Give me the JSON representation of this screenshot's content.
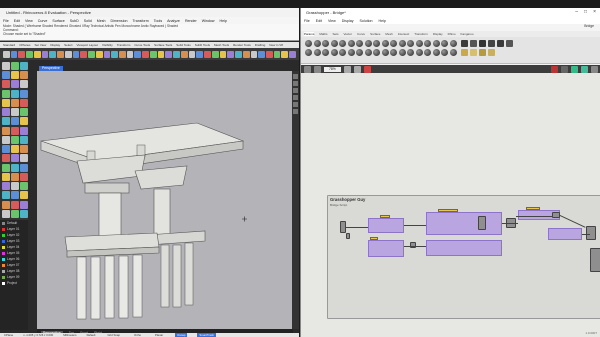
{
  "rhino": {
    "title": "Untitled - Rhinoceros 8 Evaluation - Perspective",
    "menu": [
      "File",
      "Edit",
      "View",
      "Curve",
      "Surface",
      "SubD",
      "Solid",
      "Mesh",
      "Dimension",
      "Transform",
      "Tools",
      "Analyze",
      "Render",
      "Window",
      "Help"
    ],
    "command_history": [
      "Mode: Shaded ( Wireframe Shaded Rendered Ghosted XRay Technical Artistic Pen Monochrome Arctic Raytraced ) Shaded",
      "Command:",
      "Choose mode set to \"Shaded\""
    ],
    "toolbar_tabs": [
      "Standard",
      "CPlanes",
      "Set View",
      "Display",
      "Select",
      "Viewport Layout",
      "Visibility",
      "Transform",
      "Curve Tools",
      "Surface Tools",
      "Solid Tools",
      "SubD Tools",
      "Mesh Tools",
      "Render Tools",
      "Drafting",
      "New in V8"
    ],
    "viewport_label": "Perspective",
    "layers": [
      "Default",
      "Layer 01",
      "Layer 02",
      "Layer 03",
      "Layer 04",
      "Layer 05",
      "Layer 06",
      "Layer 07",
      "Layer 08",
      "Layer 09",
      "Project"
    ],
    "view_tabs": [
      "Perspective",
      "Top",
      "Front",
      "Right"
    ],
    "status": {
      "cplane": "CPlane",
      "coords": "x -1.005 y 3.726 z 0.000",
      "units": "Millimeters",
      "layer": "Default",
      "grid_snap": "Grid Snap",
      "ortho": "Ortho",
      "planar": "Planar",
      "osnap": "Osnap",
      "smarttrack": "SmartTrack"
    }
  },
  "gh": {
    "title": "Grasshopper - Bridge*",
    "menu": [
      "File",
      "Edit",
      "View",
      "Display",
      "Solution",
      "Help"
    ],
    "doc_name": "Bridge",
    "component_tabs": [
      "Params",
      "Maths",
      "Sets",
      "Vector",
      "Curve",
      "Surface",
      "Mesh",
      "Intersect",
      "Transform",
      "Display",
      "Rhino",
      "Kangaroo"
    ],
    "zoom": "78%",
    "group_title": "Grasshopper Guy",
    "group_subtitle": "Bridge Script",
    "version": "1.0.0007"
  },
  "icons": {
    "minimize": "minimize-icon",
    "maximize": "maximize-icon",
    "close": "close-icon",
    "eye": "eye-icon"
  }
}
